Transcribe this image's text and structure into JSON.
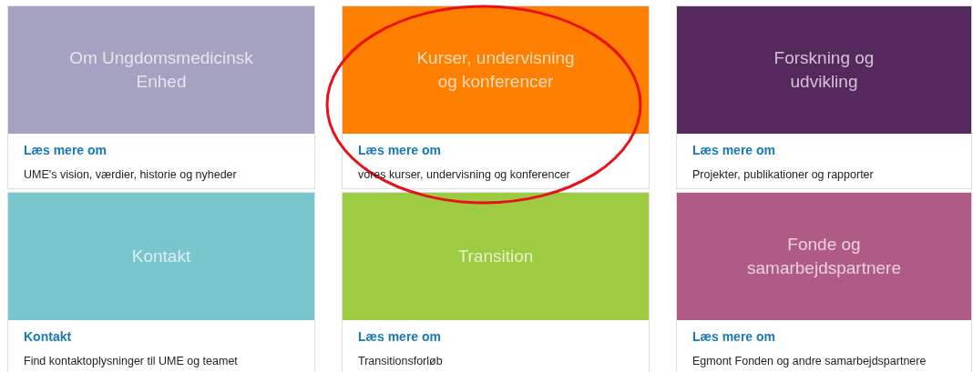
{
  "cards": [
    {
      "tile_title": "Om Ungdomsmedicinsk\nEnhed",
      "color": "#a5a1c0",
      "link": "Læs mere om",
      "description": "UME's vision, værdier, historie og nyheder",
      "highlighted": false
    },
    {
      "tile_title": "Kurser, undervisning\nog konferencer",
      "color": "#ff7f00",
      "link": "Læs mere om",
      "description": "vores kurser, undervisning og konferencer",
      "highlighted": true
    },
    {
      "tile_title": "Forskning og\nudvikling",
      "color": "#55285e",
      "link": "Læs mere om",
      "description": "Projekter, publikationer og rapporter",
      "highlighted": false
    },
    {
      "tile_title": "Kontakt",
      "color": "#79c6cc",
      "link": "Kontakt",
      "description": "Find kontaktoplysninger til UME og teamet",
      "highlighted": false
    },
    {
      "tile_title": "Transition",
      "color": "#9dcb42",
      "link": "Læs mere om",
      "description": "Transitionsforløb",
      "highlighted": false
    },
    {
      "tile_title": "Fonde og\nsamarbejdspartnere",
      "color": "#b05a86",
      "link": "Læs mere om",
      "description": "Egmont Fonden og andre samarbejdspartnere",
      "highlighted": false
    }
  ]
}
